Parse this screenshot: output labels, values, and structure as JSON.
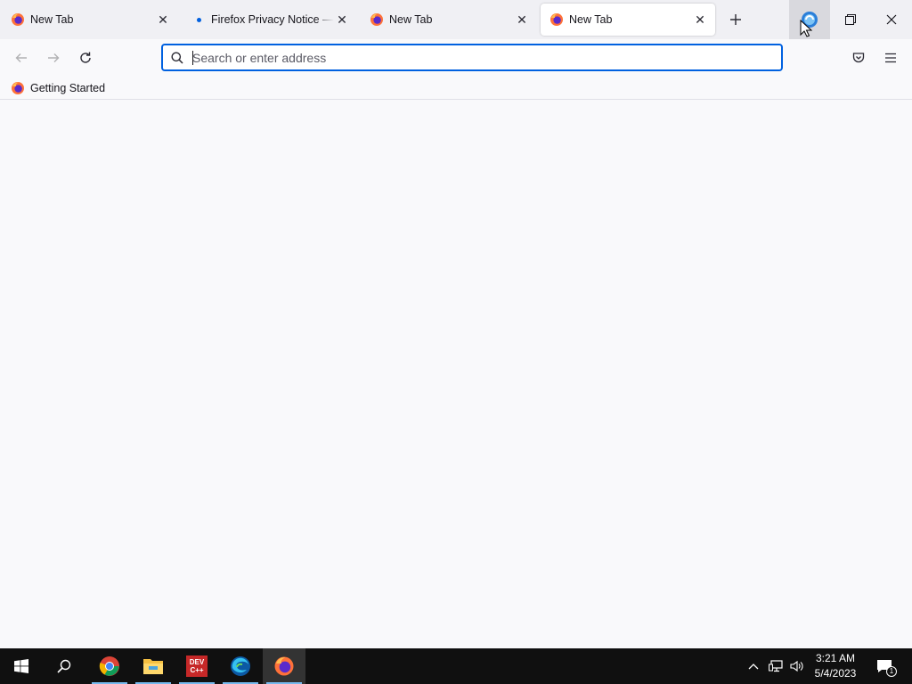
{
  "browser": {
    "tabs": [
      {
        "title": "New Tab",
        "active": false,
        "favicon": "firefox-icon",
        "has_close": true
      },
      {
        "title": "Firefox Privacy Notice — Mozilla",
        "active": false,
        "favicon": "loading-dot",
        "has_close": true
      },
      {
        "title": "New Tab",
        "active": false,
        "favicon": "firefox-icon",
        "has_close": true
      },
      {
        "title": "New Tab",
        "active": true,
        "favicon": "firefox-icon",
        "has_close": true
      }
    ],
    "new_tab_icon": "plus-icon",
    "window_controls": [
      "minimize-icon",
      "restore-icon",
      "close-icon"
    ]
  },
  "navbar": {
    "back_icon": "back-arrow-icon",
    "forward_icon": "forward-arrow-icon",
    "reload_icon": "reload-icon",
    "address": {
      "value": "",
      "placeholder": "Search or enter address"
    },
    "pocket_icon": "pocket-icon",
    "menu_icon": "hamburger-menu-icon"
  },
  "bookmarks": {
    "items": [
      {
        "label": "Getting Started",
        "icon": "firefox-icon"
      }
    ]
  },
  "taskbar": {
    "apps": [
      {
        "name": "Google Chrome",
        "icon": "chrome-icon",
        "running": true
      },
      {
        "name": "File Explorer",
        "icon": "folder-icon",
        "running": true
      },
      {
        "name": "Dev-C++",
        "icon": "devcpp-icon",
        "label": "DEV\nC++",
        "running": true
      },
      {
        "name": "Microsoft Edge",
        "icon": "edge-icon",
        "running": true
      },
      {
        "name": "Firefox",
        "icon": "firefox-icon",
        "running": true,
        "active": true
      }
    ],
    "clock": {
      "time": "3:21 AM",
      "date": "5/4/2023"
    },
    "notifications_count": "1"
  },
  "colors": {
    "accent": "#0061e0",
    "tabstrip_bg": "#f0f0f4",
    "taskbar_bg": "#101010",
    "taskbar_indicator": "#76b9ed"
  }
}
